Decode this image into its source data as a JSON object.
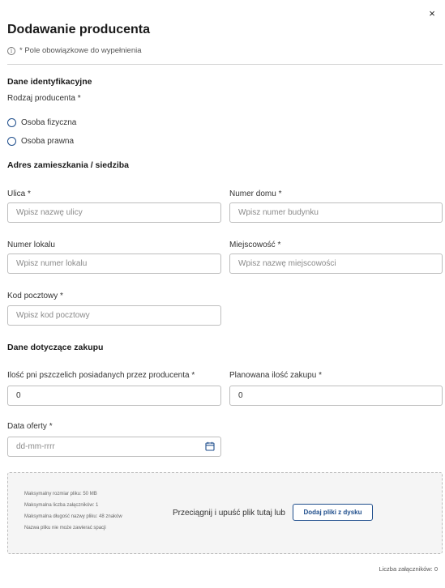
{
  "header": {
    "title": "Dodawanie producenta",
    "close_symbol": "×",
    "required_note": "* Pole obowiązkowe do wypełnienia"
  },
  "identification": {
    "section_title": "Dane identyfikacyjne",
    "producer_type_label": "Rodzaj producenta *",
    "options": [
      "Osoba fizyczna",
      "Osoba prawna"
    ]
  },
  "address": {
    "section_title": "Adres zamieszkania / siedziba",
    "street": {
      "label": "Ulica *",
      "placeholder": "Wpisz nazwę ulicy",
      "value": ""
    },
    "house_number": {
      "label": "Numer domu *",
      "placeholder": "Wpisz numer budynku",
      "value": ""
    },
    "apartment_number": {
      "label": "Numer lokalu",
      "placeholder": "Wpisz numer lokalu",
      "value": ""
    },
    "city": {
      "label": "Miejscowość *",
      "placeholder": "Wpisz nazwę miejscowości",
      "value": ""
    },
    "postal_code": {
      "label": "Kod pocztowy *",
      "placeholder": "Wpisz kod pocztowy",
      "value": ""
    }
  },
  "purchase": {
    "section_title": "Dane dotyczące zakupu",
    "hives_count": {
      "label": "Ilość pni pszczelich posiadanych przez producenta *",
      "value": "0"
    },
    "planned_amount": {
      "label": "Planowana ilość zakupu *",
      "value": "0"
    },
    "offer_date": {
      "label": "Data oferty *",
      "placeholder": "dd-mm-rrrr",
      "value": ""
    }
  },
  "upload": {
    "info_lines": [
      "Maksymalny rozmiar pliku: 50 MB",
      "Maksymalna liczba załączników: 1",
      "Maksymalna długość nazwy pliku: 48 znaków",
      "Nazwa pliku nie może zawierać spacji"
    ],
    "drop_text": "Przeciągnij i upuść plik tutaj lub",
    "button_label": "Dodaj pliki z dysku",
    "attachment_counter": "Liczba załączników: 0"
  },
  "colors": {
    "accent": "#1f4e8c",
    "border": "#bdbdbd",
    "dropzone_bg": "#f5f5f5"
  },
  "icons": {
    "close": "close-icon",
    "info": "info-icon",
    "calendar": "calendar-icon"
  }
}
